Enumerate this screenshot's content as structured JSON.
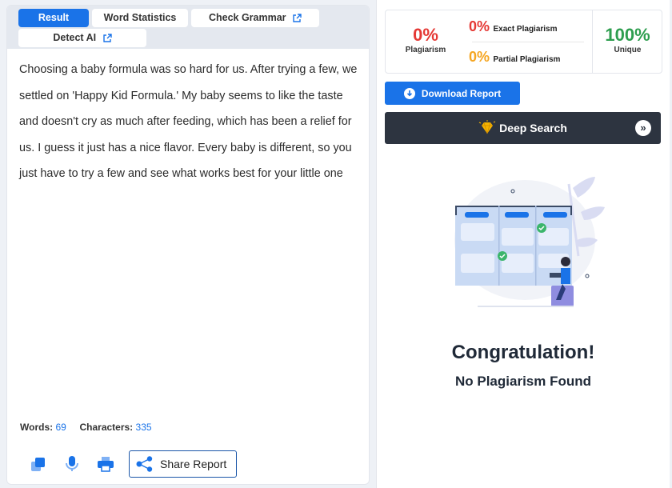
{
  "tabs": {
    "result": "Result",
    "word_statistics": "Word Statistics",
    "check_grammar": "Check Grammar",
    "detect_ai": "Detect AI"
  },
  "content": {
    "text": "Choosing a baby formula was so hard for us. After trying a few, we settled on 'Happy Kid Formula.' My baby seems to like the taste and doesn't cry as much after feeding, which has been a relief for us. I guess it just has a nice flavor. Every baby is different, so you just have to try a few and see what works best for your little one"
  },
  "counts": {
    "words_label": "Words:",
    "words_value": "69",
    "chars_label": "Characters:",
    "chars_value": "335"
  },
  "toolbar": {
    "share_label": "Share Report"
  },
  "stats": {
    "plagiarism_value": "0%",
    "plagiarism_label": "Plagiarism",
    "exact_value": "0%",
    "exact_label": "Exact Plagiarism",
    "partial_value": "0%",
    "partial_label": "Partial Plagiarism",
    "unique_value": "100%",
    "unique_label": "Unique"
  },
  "actions": {
    "download_label": "Download Report",
    "deep_search_label": "Deep Search"
  },
  "result": {
    "title": "Congratulation!",
    "subtitle": "No Plagiarism Found"
  },
  "colors": {
    "accent": "#1a73e8",
    "danger": "#e53935",
    "success": "#2e9e4f",
    "partial": "#f5a623",
    "dark_button": "#2d3440"
  },
  "icons": {
    "check_grammar": "external-link-icon",
    "detect_ai": "external-link-icon",
    "copy": "copy-icon",
    "mic": "microphone-icon",
    "print": "printer-icon",
    "share": "share-icon",
    "download": "download-icon",
    "deep_search": "diamond-icon",
    "deep_search_arrow": "double-chevron-right-icon"
  }
}
